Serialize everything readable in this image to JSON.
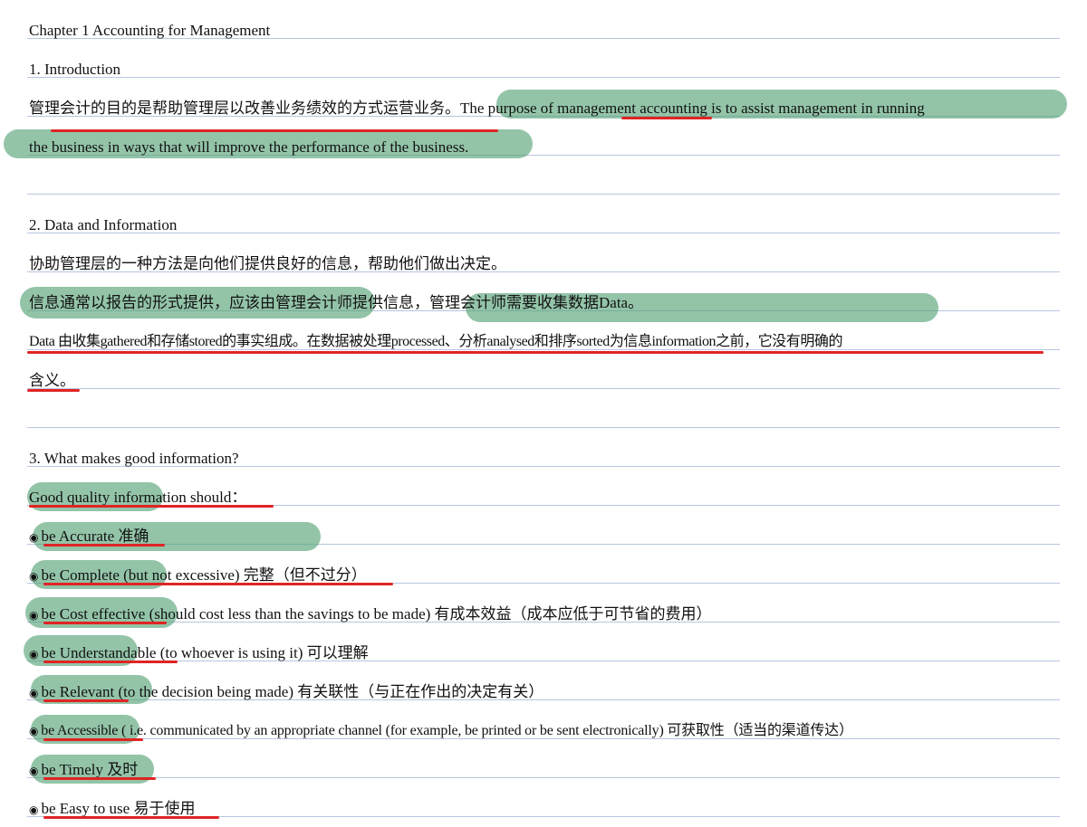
{
  "colors": {
    "highlight": "#50a073",
    "underline": "#e02424",
    "ruled_line": "#b8c6df"
  },
  "chapter_title": "Chapter 1 Accounting for Management",
  "s1": {
    "heading": "1.   Introduction",
    "line1_zh": "管理会计的目的是帮助管理层以改善业务绩效的方式运营业务。",
    "line1_a": "The purpose of ",
    "line1_b": "management",
    "line1_c": " accounting is to assist management in running",
    "line2": "the business in ways that will improve the performance of the business."
  },
  "s2": {
    "heading": "2. Data and Information",
    "line1": "协助管理层的一种方法是向他们提供良好的信息，帮助他们做出决定。",
    "line2": "信息通常以报告的形式提供，应该由管理会计师提供信息，管理会计师需要收集数据Data。",
    "line3": "Data 由收集gathered和存储stored的事实组成。在数据被处理processed、分析analysed和排序sorted为信息information之前，它没有明确的",
    "line4": "含义。"
  },
  "s3": {
    "heading": "3. What makes good information?",
    "intro": "Good quality information should：",
    "bullet_icon": "radio-bullet-icon",
    "items": [
      {
        "a": "be Accurate",
        "b": " 准确"
      },
      {
        "a": "be Complete (bu",
        "b": "t not excessive) 完整（但不过分）"
      },
      {
        "a": "be Cost effective",
        "b": " (should cost less than the savings to be made) 有成本效益（成本应低于可节省的费用）"
      },
      {
        "a": "be Understandable",
        "b": " (to whoever is using it) 可以理解"
      },
      {
        "a": "be Relevant",
        "b": " (to the decision being made) 有关联性（与正在作出的决定有关）"
      },
      {
        "a": "be Accessible",
        "b": " ( i.e. communicated by an appropriate channel (for example, be printed or be sent electronically) 可获取性（适当的渠道传达）"
      },
      {
        "a": "be Timely",
        "b": " 及时"
      },
      {
        "a": "be Easy to use",
        "b": " 易于使用"
      }
    ]
  }
}
